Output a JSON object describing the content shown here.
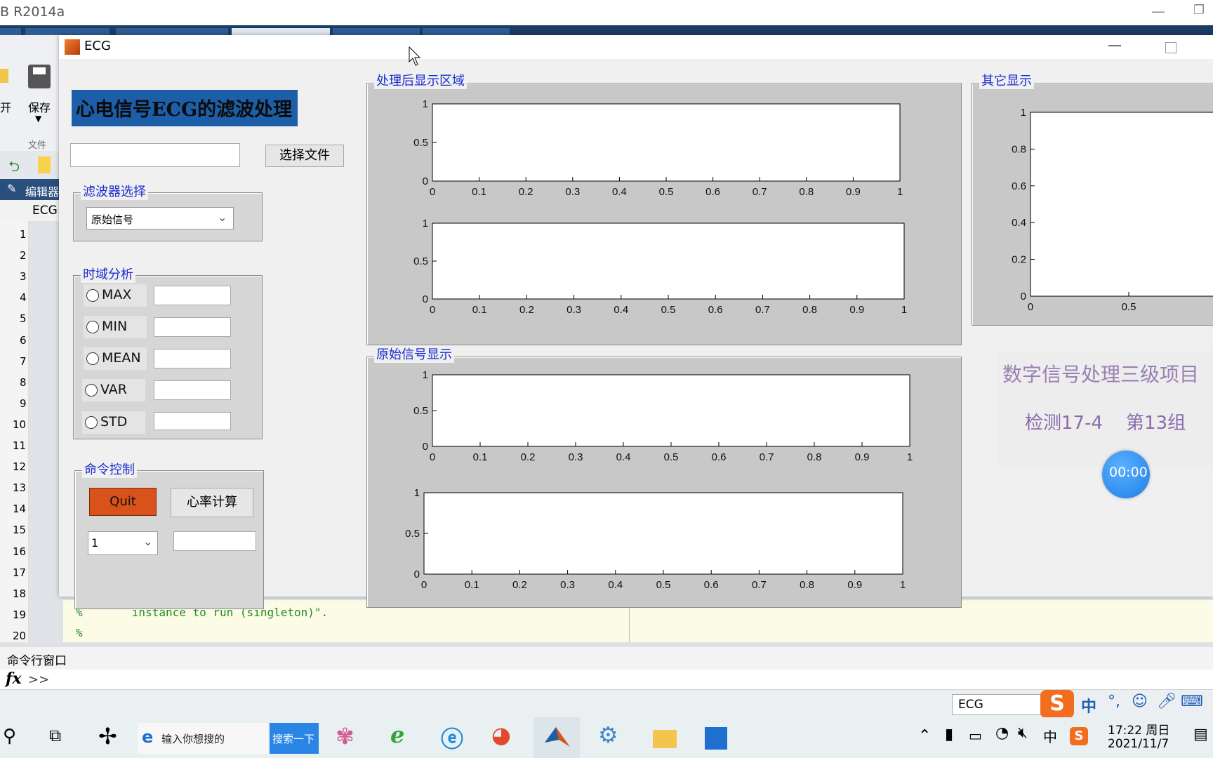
{
  "matlab": {
    "title": "B R2014a",
    "ribbon": {
      "open_label": "开",
      "save_label": "保存",
      "file_group": "文件"
    },
    "editor_tab": "编辑器",
    "file_tab": "ECG",
    "line_numbers": [
      "1",
      "2",
      "3",
      "4",
      "5",
      "6",
      "7",
      "8",
      "9",
      "10",
      "11",
      "12",
      "13",
      "14",
      "15",
      "16",
      "17",
      "18",
      "19",
      "20"
    ],
    "code_lines": [
      {
        "prefix": "%",
        "text": "      instance to run (singleton)\"."
      },
      {
        "prefix": "%",
        "text": ""
      }
    ],
    "command_window": {
      "title": "命令行窗口",
      "fx": "fx",
      "prompt": ">>"
    },
    "status_field": "ECG"
  },
  "ecg": {
    "window_title": "ECG",
    "heading": "心电信号ECG的滤波处理",
    "file_path_value": "",
    "select_file_button": "选择文件",
    "filter_panel": {
      "title": "滤波器选择",
      "selected": "原始信号"
    },
    "time_panel": {
      "title": "时域分析",
      "items": [
        {
          "label": "MAX",
          "value": ""
        },
        {
          "label": "MIN",
          "value": ""
        },
        {
          "label": "MEAN",
          "value": ""
        },
        {
          "label": "VAR",
          "value": ""
        },
        {
          "label": "STD",
          "value": ""
        }
      ]
    },
    "command_panel": {
      "title": "命令控制",
      "quit_button": "Quit",
      "heart_rate_button": "心率计算",
      "select_value": "1",
      "result_value": ""
    },
    "processed_panel_title": "处理后显示区域",
    "original_panel_title": "原始信号显示",
    "other_panel_title": "其它显示",
    "project_title": "数字信号处理三级项目",
    "class_label": "检测17-4",
    "group_label": "第13组",
    "timer": "00:00"
  },
  "chart_data": [
    {
      "type": "line",
      "title": "",
      "x_ticks": [
        "0",
        "0.1",
        "0.2",
        "0.3",
        "0.4",
        "0.5",
        "0.6",
        "0.7",
        "0.8",
        "0.9",
        "1"
      ],
      "y_ticks": [
        "0",
        "0.5",
        "1"
      ],
      "xlim": [
        0,
        1
      ],
      "ylim": [
        0,
        1
      ],
      "series": []
    },
    {
      "type": "line",
      "title": "",
      "x_ticks": [
        "0",
        "0.1",
        "0.2",
        "0.3",
        "0.4",
        "0.5",
        "0.6",
        "0.7",
        "0.8",
        "0.9",
        "1"
      ],
      "y_ticks": [
        "0",
        "0.5",
        "1"
      ],
      "xlim": [
        0,
        1
      ],
      "ylim": [
        0,
        1
      ],
      "series": []
    },
    {
      "type": "line",
      "title": "",
      "x_ticks": [
        "0",
        "0.1",
        "0.2",
        "0.3",
        "0.4",
        "0.5",
        "0.6",
        "0.7",
        "0.8",
        "0.9",
        "1"
      ],
      "y_ticks": [
        "0",
        "0.5",
        "1"
      ],
      "xlim": [
        0,
        1
      ],
      "ylim": [
        0,
        1
      ],
      "series": []
    },
    {
      "type": "line",
      "title": "",
      "x_ticks": [
        "0",
        "0.1",
        "0.2",
        "0.3",
        "0.4",
        "0.5",
        "0.6",
        "0.7",
        "0.8",
        "0.9",
        "1"
      ],
      "y_ticks": [
        "0",
        "0.5",
        "1"
      ],
      "xlim": [
        0,
        1
      ],
      "ylim": [
        0,
        1
      ],
      "series": []
    },
    {
      "type": "line",
      "title": "",
      "x_ticks": [
        "0",
        "0.5"
      ],
      "y_ticks": [
        "0",
        "0.2",
        "0.4",
        "0.6",
        "0.8",
        "1"
      ],
      "xlim": [
        0,
        1
      ],
      "ylim": [
        0,
        1
      ],
      "series": []
    }
  ],
  "taskbar": {
    "search_placeholder": "输入你想搜的",
    "search_button": "搜索一下",
    "time": "17:22 周日",
    "date": "2021/11/7",
    "ime_label": "中",
    "tray_lang": "中"
  }
}
